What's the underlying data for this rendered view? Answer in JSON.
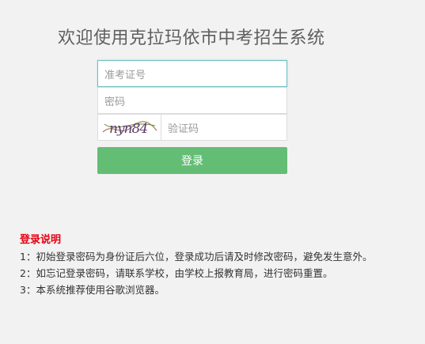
{
  "page": {
    "title": "欢迎使用克拉玛依市中考招生系统"
  },
  "form": {
    "exam_id_placeholder": "准考证号",
    "password_placeholder": "密码",
    "captcha_text": "nyn84",
    "captcha_placeholder": "验证码",
    "login_label": "登录"
  },
  "instructions": {
    "title": "登录说明",
    "items": [
      "1：初始登录密码为身份证后六位，登录成功后请及时修改密码，避免发生意外。",
      "2：如忘记登录密码，请联系学校，由学校上报教育局，进行密码重置。",
      "3：本系统推荐使用谷歌浏览器。"
    ]
  },
  "colors": {
    "background": "#f2f2f2",
    "button": "#64bd74",
    "focus_border": "#6cc0c3",
    "instructions_title": "#e60012"
  }
}
